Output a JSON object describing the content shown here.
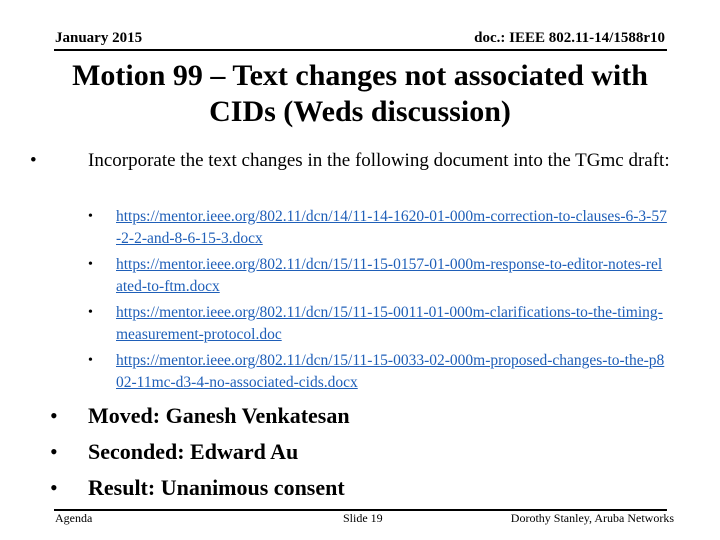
{
  "header": {
    "date": "January 2015",
    "doc_id": "doc.: IEEE 802.11-14/1588r10"
  },
  "title": "Motion  99  – Text changes not associated with CIDs (Weds discussion)",
  "body": {
    "intro": "Incorporate the text changes in the following document into the TGmc draft:",
    "links": [
      "https://mentor.ieee.org/802.11/dcn/14/11-14-1620-01-000m-correction-to-clauses-6-3-57-2-2-and-8-6-15-3.docx",
      "https://mentor.ieee.org/802.11/dcn/15/11-15-0157-01-000m-response-to-editor-notes-related-to-ftm.docx",
      "https://mentor.ieee.org/802.11/dcn/15/11-15-0011-01-000m-clarifications-to-the-timing-measurement-protocol.doc",
      "https://mentor.ieee.org/802.11/dcn/15/11-15-0033-02-000m-proposed-changes-to-the-p802-11mc-d3-4-no-associated-cids.docx"
    ],
    "motion_details": [
      "Moved: Ganesh Venkatesan",
      "Seconded: Edward Au",
      "Result: Unanimous consent"
    ],
    "bullet_symbol": "•"
  },
  "footer": {
    "left": "Agenda",
    "center": "Slide 19",
    "right": "Dorothy Stanley, Aruba Networks"
  },
  "colors": {
    "link": "#1f5fb8"
  }
}
